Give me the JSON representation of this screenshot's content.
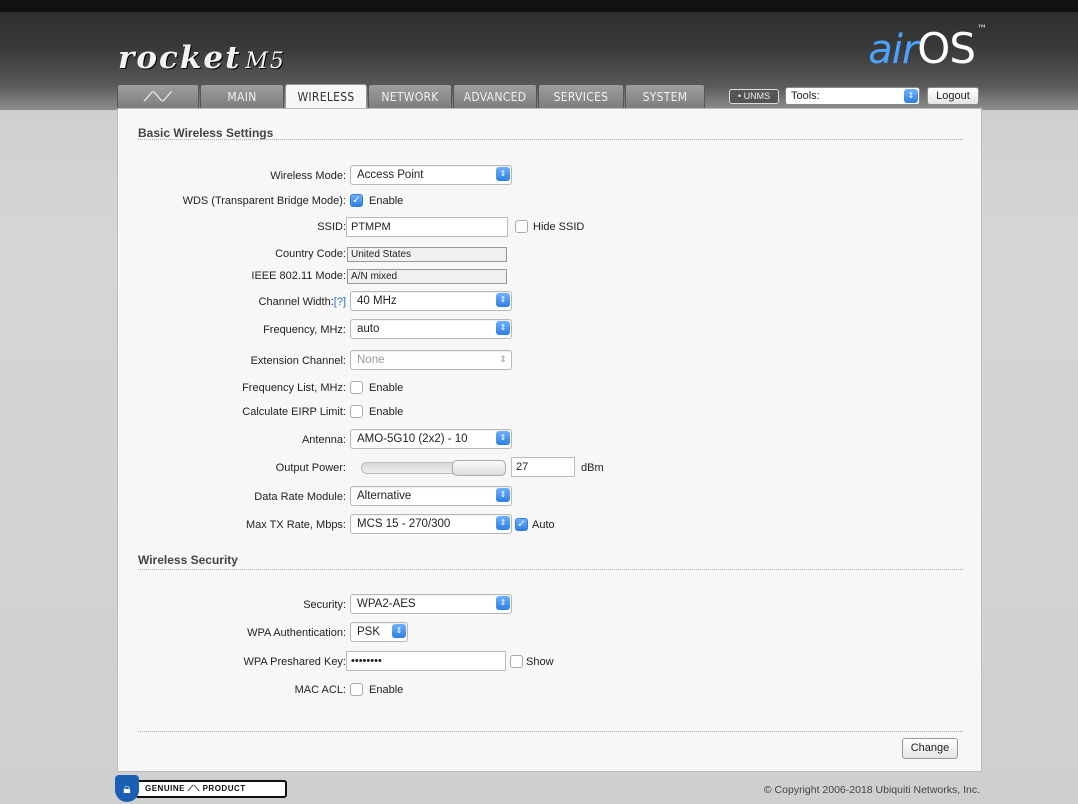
{
  "header": {
    "brand": "rocket",
    "model": "M5",
    "logo_air": "air",
    "logo_os": "OS",
    "logo_tm": "™"
  },
  "tabs": [
    {
      "label": "",
      "icon": "ubiquiti-logo-icon"
    },
    {
      "label": "MAIN"
    },
    {
      "label": "WIRELESS",
      "active": true
    },
    {
      "label": "NETWORK"
    },
    {
      "label": "ADVANCED"
    },
    {
      "label": "SERVICES"
    },
    {
      "label": "SYSTEM"
    }
  ],
  "toolbar": {
    "unms_label": "• UNMS",
    "tools_value": "Tools:",
    "logout_label": "Logout"
  },
  "basic": {
    "title": "Basic Wireless Settings",
    "wireless_mode_label": "Wireless Mode:",
    "wireless_mode_value": "Access Point",
    "wds_label": "WDS (Transparent Bridge Mode):",
    "wds_enable": "Enable",
    "ssid_label": "SSID:",
    "ssid_value": "PTMPM",
    "hide_ssid": "Hide SSID",
    "country_label": "Country Code:",
    "country_value": "United States",
    "ieee_label": "IEEE 802.11 Mode:",
    "ieee_value": "A/N mixed",
    "channel_width_label": "Channel Width:",
    "channel_width_help": "[?]",
    "channel_width_value": "40 MHz",
    "frequency_label": "Frequency, MHz:",
    "frequency_value": "auto",
    "extension_label": "Extension Channel:",
    "extension_value": "None",
    "freq_list_label": "Frequency List, MHz:",
    "freq_list_enable": "Enable",
    "eirp_label": "Calculate EIRP Limit:",
    "eirp_enable": "Enable",
    "antenna_label": "Antenna:",
    "antenna_value": "AMO-5G10 (2x2) - 10",
    "output_power_label": "Output Power:",
    "output_power_value": "27",
    "output_power_unit": "dBm",
    "data_rate_label": "Data Rate Module:",
    "data_rate_value": "Alternative",
    "max_tx_label": "Max TX Rate, Mbps:",
    "max_tx_value": "MCS 15 - 270/300",
    "max_tx_auto": "Auto"
  },
  "security": {
    "title": "Wireless Security",
    "security_label": "Security:",
    "security_value": "WPA2-AES",
    "wpa_auth_label": "WPA Authentication:",
    "wpa_auth_value": "PSK",
    "wpa_key_label": "WPA Preshared Key:",
    "wpa_key_value": "••••••••",
    "show_label": "Show",
    "mac_acl_label": "MAC ACL:",
    "mac_acl_enable": "Enable"
  },
  "actions": {
    "change_label": "Change"
  },
  "footer": {
    "genuine_text": "GENUINE ⟋⟍ PRODUCT",
    "copyright": "© Copyright 2006-2018 Ubiquiti Networks, Inc."
  }
}
